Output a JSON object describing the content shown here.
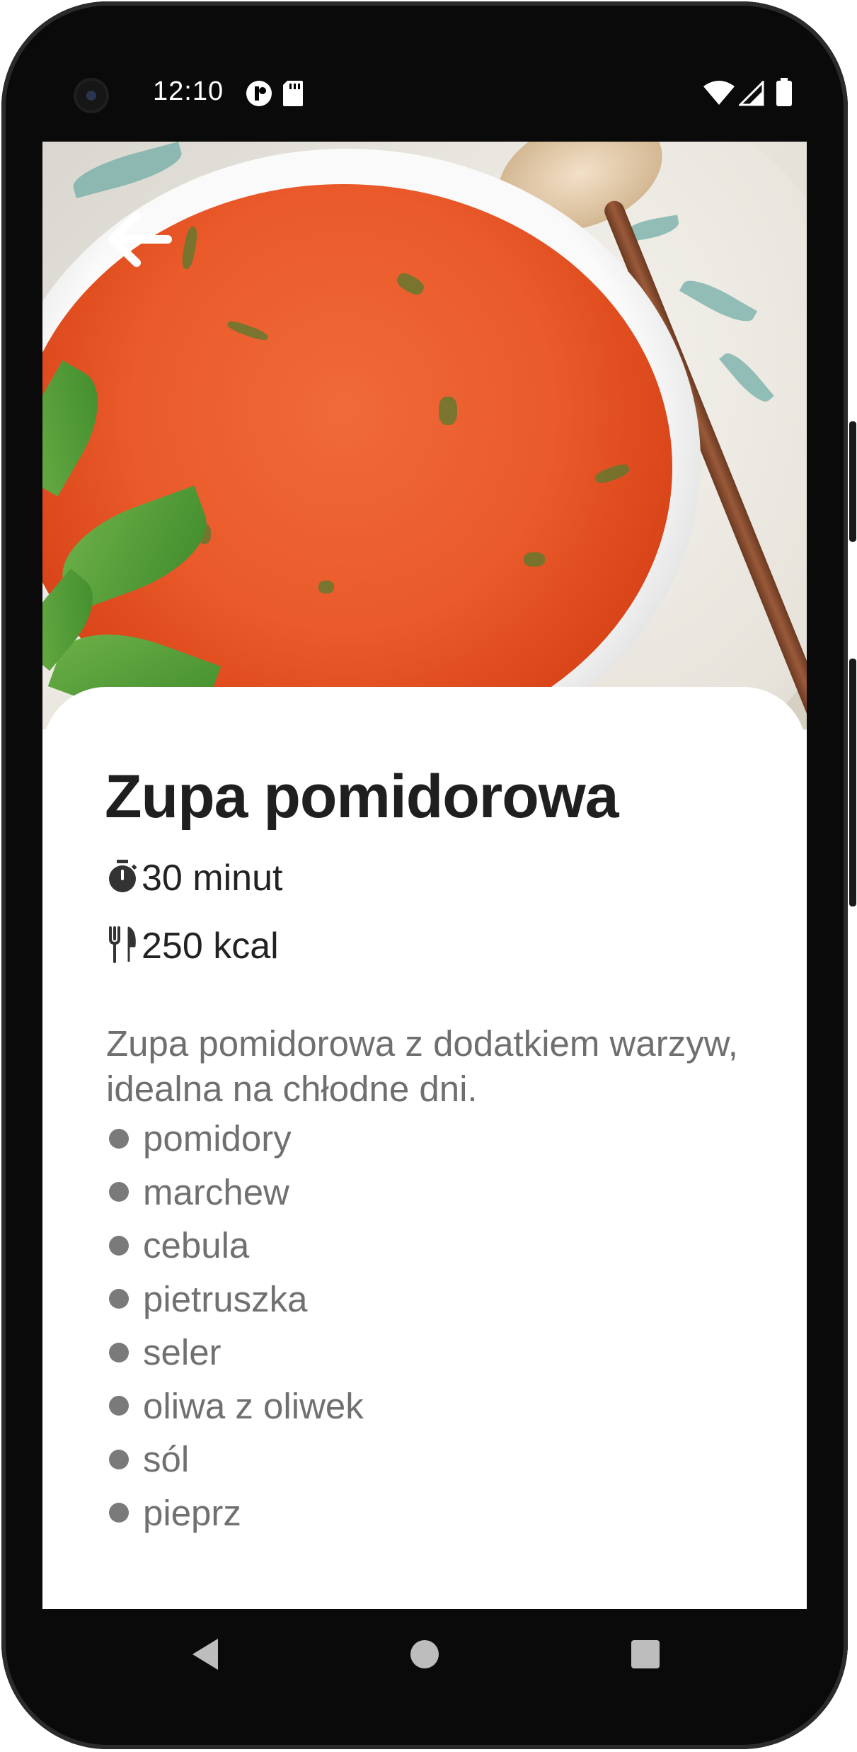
{
  "status_bar": {
    "time": "12:10",
    "icons": [
      "app-notification-icon",
      "sd-card-icon",
      "wifi-icon",
      "signal-icon",
      "battery-icon"
    ]
  },
  "hero": {
    "image": "tomato-soup-photo",
    "back_icon": "arrow-back-icon"
  },
  "recipe": {
    "title": "Zupa pomidorowa",
    "time_icon": "timer-icon",
    "time": "30 minut",
    "calories_icon": "cutlery-icon",
    "calories": "250 kcal",
    "description": "Zupa pomidorowa z dodatkiem warzyw, idealna na chłodne dni.",
    "ingredients": [
      "pomidory",
      "marchew",
      "cebula",
      "pietruszka",
      "seler",
      "oliwa z oliwek",
      "sól",
      "pieprz"
    ]
  },
  "nav_bar": {
    "back": "nav-back-icon",
    "home": "nav-home-icon",
    "recents": "nav-recents-icon"
  },
  "colors": {
    "title": "#1f1f1f",
    "body_text": "#6f6f6f",
    "soup": "#ea5a2a",
    "frame": "#0a0a0a"
  }
}
